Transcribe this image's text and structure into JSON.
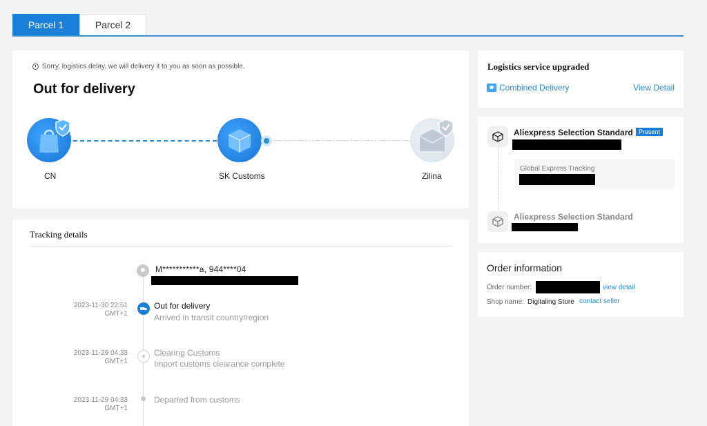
{
  "tabs": [
    {
      "label": "Parcel 1",
      "active": true
    },
    {
      "label": "Parcel 2",
      "active": false
    }
  ],
  "status": {
    "notice": "Sorry, logistics delay, we will delivery it to you as soon as possible.",
    "title": "Out for delivery",
    "stages": [
      {
        "label": "CN",
        "state": "done"
      },
      {
        "label": "SK Customs",
        "state": "current"
      },
      {
        "label": "Zilina",
        "state": "pending"
      }
    ]
  },
  "tracking": {
    "title": "Tracking details",
    "address": "M***********a,  944****04",
    "events": [
      {
        "date": "2023-11-30 22:51",
        "tz": "GMT+1",
        "title": "Out for delivery",
        "subtitle": "Arrived in transit country/region",
        "state": "current"
      },
      {
        "date": "2023-11-29 04:33",
        "tz": "GMT+1",
        "title": "Clearing Customs",
        "subtitle": "Import customs clearance complete",
        "state": "past"
      },
      {
        "date": "2023-11-29 04:33",
        "tz": "GMT+1",
        "title": "Departed from customs",
        "subtitle": "",
        "state": "past"
      }
    ]
  },
  "logistics": {
    "title": "Logistics service upgraded",
    "combined_label": "Combined Delivery",
    "view_detail": "View Detail"
  },
  "services": {
    "primary_name": "Aliexpress Selection Standard",
    "present_badge": "Present",
    "sub_tracking_label": "Global Express Tracking",
    "secondary_name": "Aliexpress Selection Standard"
  },
  "order": {
    "title": "Order information",
    "number_label": "Order number:",
    "view_detail": "view detail",
    "shop_label": "Shop name:",
    "shop_name": "Digitaling Store",
    "contact_seller": "contact seller"
  },
  "colors": {
    "accent": "#1a7fd8",
    "link": "#2a8bd3",
    "background": "#f4f4f4"
  }
}
